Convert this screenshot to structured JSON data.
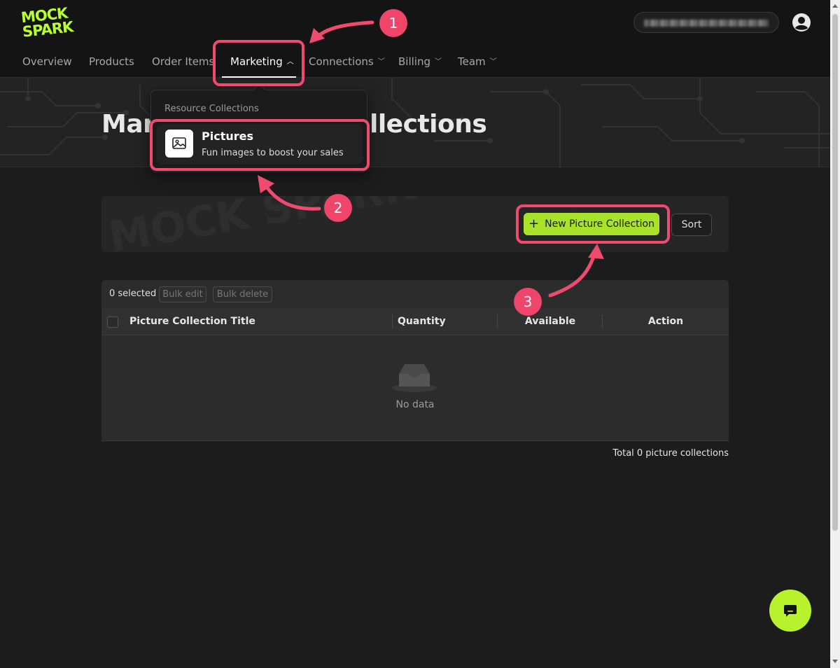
{
  "brand": {
    "logo_line1": "MOCK",
    "logo_line2": "SPARK",
    "accent": "#b7ff2e"
  },
  "nav": {
    "items": [
      {
        "label": "Overview"
      },
      {
        "label": "Products"
      },
      {
        "label": "Order Items"
      },
      {
        "label": "Marketing",
        "active": true,
        "expanded": true
      },
      {
        "label": "Connections"
      },
      {
        "label": "Billing"
      },
      {
        "label": "Team"
      }
    ]
  },
  "hero": {
    "title_start": "Mar",
    "title_end": "llections"
  },
  "dropdown": {
    "heading": "Resource Collections",
    "item": {
      "title": "Pictures",
      "subtitle": "Fun images to boost your sales",
      "icon": "image-icon"
    }
  },
  "toolbar": {
    "watermark": "MOCK SPARK",
    "new_button": "New Picture Collection",
    "sort_button": "Sort"
  },
  "table": {
    "selected_text": "0 selected",
    "bulk_edit": "Bulk edit",
    "bulk_delete": "Bulk delete",
    "columns": [
      "Picture Collection Title",
      "Quantity",
      "Available",
      "Action"
    ],
    "empty_text": "No data",
    "total_text": "Total 0 picture collections"
  },
  "annotations": {
    "badges": [
      "1",
      "2",
      "3"
    ],
    "highlight_color": "#f04a6e"
  }
}
